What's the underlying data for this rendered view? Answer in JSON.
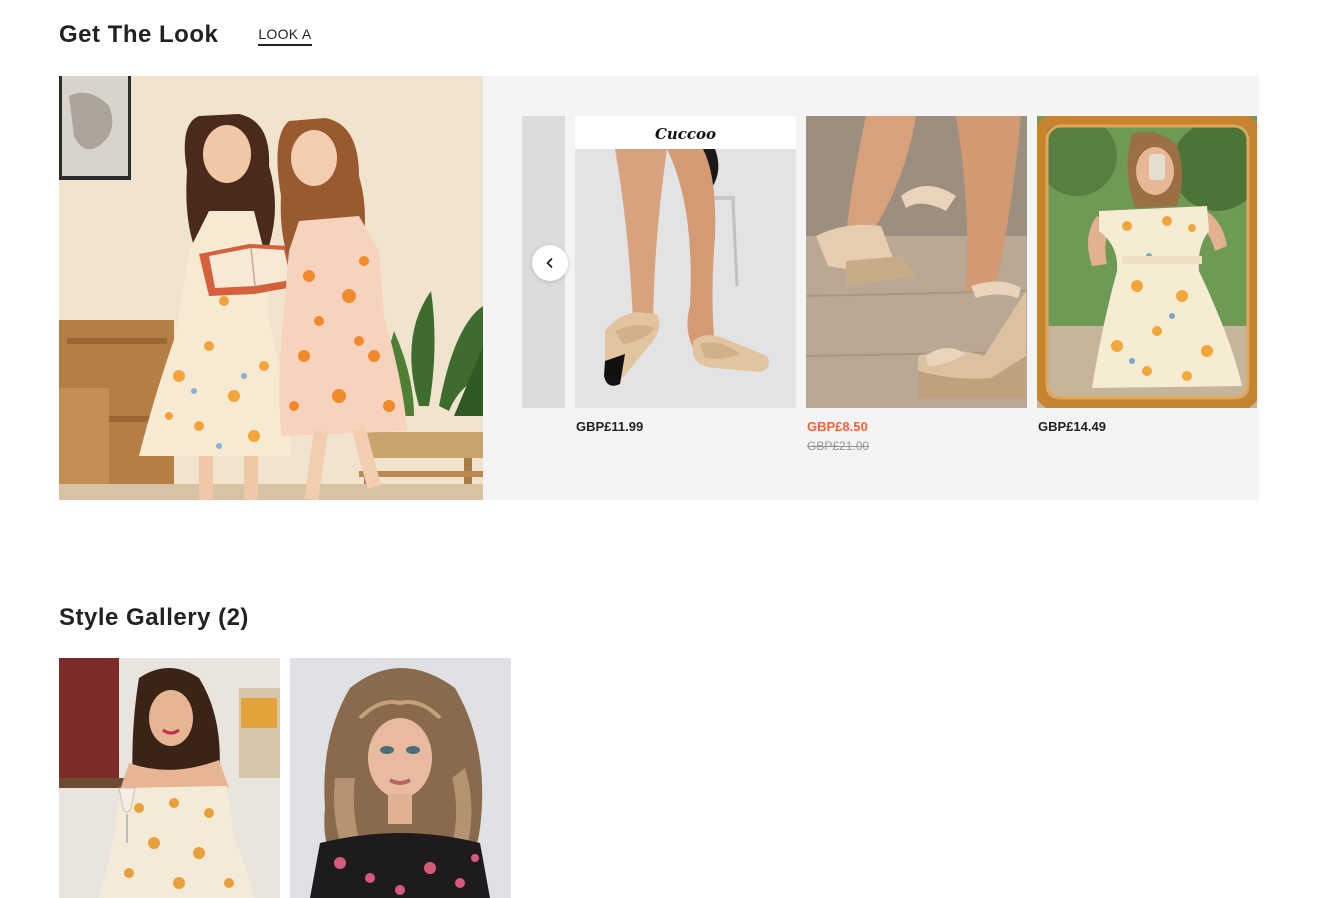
{
  "get_the_look": {
    "title": "Get The Look",
    "tabs": [
      {
        "label": "LOOK A",
        "active": true
      }
    ]
  },
  "look": {
    "products": [
      {
        "brand": "Cuccoo",
        "price": "GBP£11.99",
        "on_sale": false,
        "original_price": ""
      },
      {
        "brand": "",
        "price": "GBP£8.50",
        "on_sale": true,
        "original_price": "GBP£21.00"
      },
      {
        "brand": "",
        "price": "GBP£14.49",
        "on_sale": false,
        "original_price": ""
      }
    ]
  },
  "style_gallery": {
    "title": "Style Gallery (2)",
    "items": [
      {
        "kind": "photo"
      },
      {
        "kind": "photo"
      }
    ]
  },
  "colors": {
    "sale": "#fa6338",
    "text": "#222222",
    "muted": "#959595",
    "panel_bg": "#f4f4f4"
  },
  "icons": {
    "prev": "chevron-left-icon"
  }
}
